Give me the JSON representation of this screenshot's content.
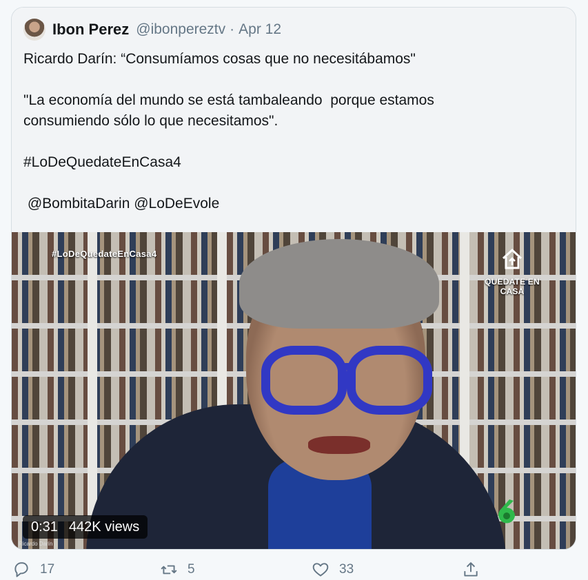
{
  "tweet": {
    "author_name": "Ibon Perez",
    "author_handle": "@ibonpereztv",
    "separator": "·",
    "date": "Apr 12",
    "body": "Ricardo Darín: “Consumíamos cosas que no necesitábamos\"\n\n\"La economía del mundo se está tambaleando  porque estamos\nconsumiendo sólo lo que necesitamos\".\n\n#LoDeQuedateEnCasa4\n\n @BombitaDarin @LoDeEvole"
  },
  "video": {
    "overlay_hashtag": "#LoDeQuedateEnCasa4",
    "brand_label": "QUEDATE EN CASA",
    "duration": "0:31",
    "views": "442K views",
    "credit": "Ricardo Darín"
  },
  "actions": {
    "replies": "17",
    "retweets": "5",
    "likes": "33"
  },
  "icons": {
    "reply": "reply-icon",
    "retweet": "retweet-icon",
    "like": "heart-icon",
    "share": "share-icon"
  },
  "colors": {
    "muted": "#657786",
    "video_accent": "#3138c4",
    "lasexta_green": "#2fb94b"
  }
}
